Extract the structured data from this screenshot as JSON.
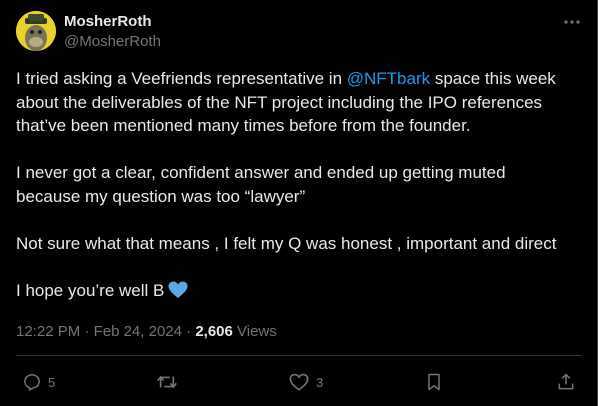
{
  "author": {
    "display_name": "MosherRoth",
    "handle": "@MosherRoth",
    "avatar_colors": {
      "background": "#e8d22a",
      "ape": "#7a7358",
      "hat": "#2e3a24"
    }
  },
  "tweet": {
    "para1_before": "I tried asking a Veefriends representative in ",
    "mention": "@NFTbark",
    "para1_after_line1": " space this week",
    "para1_line2": "about the deliverables of the NFT project including the IPO references",
    "para1_line3": "that’ve been mentioned many times before from the founder.",
    "para2_line1": "I never got a clear, confident answer and ended up getting muted",
    "para2_line2": "because my question was too “lawyer”",
    "para3": "Not sure what that means , I felt my Q  was honest , important and direct",
    "para4": "I hope you’re well B",
    "emoji": "blue-heart"
  },
  "meta": {
    "time": "12:22 PM",
    "sep1": " · ",
    "date": "Feb 24, 2024",
    "sep2": " · ",
    "views_count": "2,606",
    "views_label": " Views"
  },
  "actions": {
    "reply_count": "5",
    "repost_count": "",
    "like_count": "3"
  },
  "colors": {
    "background": "#000000",
    "text": "#e7e9ea",
    "secondary": "#71767b",
    "accent": "#1d9bf0",
    "divider": "#2f3336",
    "heart": "#5aa9e6"
  }
}
